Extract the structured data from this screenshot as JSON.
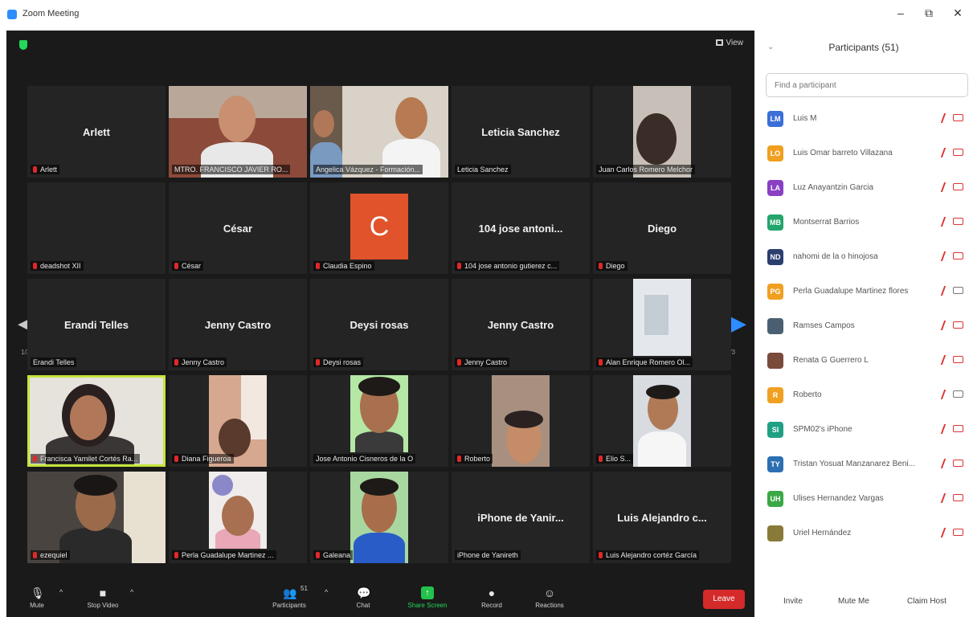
{
  "window": {
    "title": "Zoom Meeting",
    "controls": [
      "–",
      "⧉",
      "✕"
    ]
  },
  "meeting": {
    "view_label": "View",
    "page_left": "1/3",
    "page_right": "1/3"
  },
  "tiles": [
    {
      "center": "Arlett",
      "label": "Arlett"
    },
    {
      "center": "",
      "label": "MTRO. FRANCISCO JAVIER RO..."
    },
    {
      "center": "",
      "label": "Angelica Vázquez - Formación..."
    },
    {
      "center": "Leticia Sanchez",
      "label": "Leticia Sanchez"
    },
    {
      "center": "",
      "label": "Juan Carlos Romero Melchor"
    },
    {
      "center": "",
      "label": "deadshot XII"
    },
    {
      "center": "César",
      "label": "César"
    },
    {
      "center": "",
      "label": "Claudia Espino",
      "avatar": "C"
    },
    {
      "center": "104 jose antoni...",
      "label": "104 jose antonio gutierez c..."
    },
    {
      "center": "Diego",
      "label": "Diego"
    },
    {
      "center": "Erandi Telles",
      "label": "Erandi Telles"
    },
    {
      "center": "Jenny Castro",
      "label": "Jenny Castro"
    },
    {
      "center": "Deysi rosas",
      "label": "Deysi rosas"
    },
    {
      "center": "Jenny Castro",
      "label": "Jenny Castro"
    },
    {
      "center": "",
      "label": "Alan Enrique Romero Ol..."
    },
    {
      "center": "",
      "label": "Francisca Yamilet Cortés Ra..."
    },
    {
      "center": "",
      "label": "Diana Figueroa"
    },
    {
      "center": "",
      "label": "Jose Antonio Cisneros de la O"
    },
    {
      "center": "",
      "label": "Roberto"
    },
    {
      "center": "",
      "label": "Elio S..."
    },
    {
      "center": "",
      "label": "ezequiel"
    },
    {
      "center": "",
      "label": "Perla Guadalupe Martinez ..."
    },
    {
      "center": "",
      "label": "Galeana"
    },
    {
      "center": "iPhone de Yanir...",
      "label": "iPhone de Yanireth"
    },
    {
      "center": "Luis Alejandro c...",
      "label": "Luis Alejandro cortéz García"
    }
  ],
  "toolbar": {
    "mute": "Mute",
    "stop_video": "Stop Video",
    "participants": "Participants",
    "participants_count": "51",
    "chat": "Chat",
    "share_screen": "Share Screen",
    "record": "Record",
    "reactions": "Reactions",
    "leave": "Leave"
  },
  "panel": {
    "title": "Participants (51)",
    "search_placeholder": "Find a participant",
    "participants": [
      {
        "initials": "LM",
        "name": "Luis M",
        "color": "#3b6fd8",
        "video": false
      },
      {
        "initials": "LO",
        "name": "Luis Omar barreto Villazana",
        "color": "#f0a020",
        "video": false
      },
      {
        "initials": "LA",
        "name": "Luz Anayantzin Garcia",
        "color": "#8a3fc4",
        "video": false
      },
      {
        "initials": "MB",
        "name": "Montserrat Barrios",
        "color": "#24a56c",
        "video": false
      },
      {
        "initials": "ND",
        "name": "nahomi de la o hinojosa",
        "color": "#2b3f6e",
        "video": false
      },
      {
        "initials": "PG",
        "name": "Perla Guadalupe Martinez flores",
        "color": "#f0a020",
        "video": true
      },
      {
        "initials": "",
        "name": "Ramses Campos",
        "color": "#4a6072",
        "video": false
      },
      {
        "initials": "",
        "name": "Renata G Guerrero L",
        "color": "#7a4a3a",
        "video": false
      },
      {
        "initials": "R",
        "name": "Roberto",
        "color": "#f0a020",
        "video": true
      },
      {
        "initials": "SI",
        "name": "SPM02's iPhone",
        "color": "#1fa085",
        "video": false
      },
      {
        "initials": "TY",
        "name": "Tristan Yosuat Manzanarez Beni...",
        "color": "#2c6fb2",
        "video": false
      },
      {
        "initials": "UH",
        "name": "Ulises Hernandez Vargas",
        "color": "#3aa845",
        "video": false
      },
      {
        "initials": "",
        "name": "Uriel Hernández",
        "color": "#8a7a3a",
        "video": false
      }
    ],
    "footer": {
      "invite": "Invite",
      "mute_me": "Mute Me",
      "claim_host": "Claim Host"
    }
  }
}
